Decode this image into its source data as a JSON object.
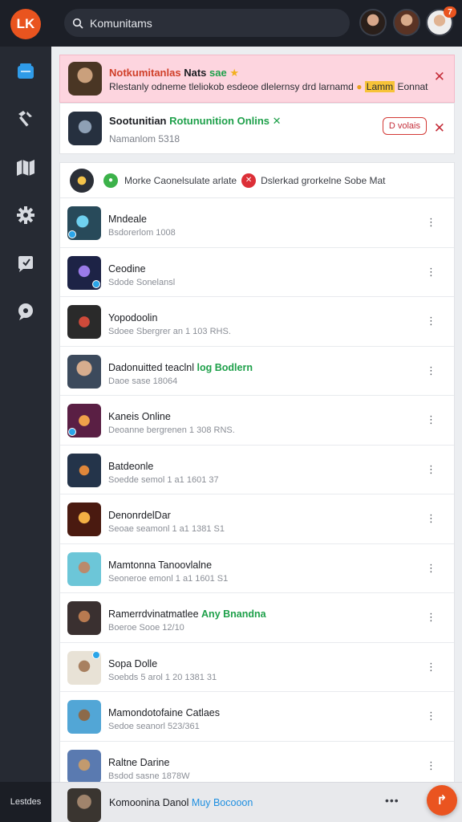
{
  "colors": {
    "accent": "#e9541f",
    "topbar": "#1c1f27",
    "sidebar": "#262a33",
    "notif_bg": "#fdd5df",
    "green": "#1ea04a",
    "blue": "#1f8fe0"
  },
  "app": {
    "logo_text": "LK"
  },
  "search": {
    "value": "Komunitams",
    "icon": "search-icon"
  },
  "header": {
    "notification_count": "7"
  },
  "sidebar": {
    "items": [
      {
        "icon": "library-icon",
        "active": true
      },
      {
        "icon": "tools-icon"
      },
      {
        "icon": "map-icon"
      },
      {
        "icon": "gear-icon"
      },
      {
        "icon": "clock-icon"
      },
      {
        "icon": "chat-icon"
      }
    ],
    "footer_label": "Lestdes"
  },
  "notifications": [
    {
      "title": "Notkumitanlas",
      "title_suffix": "Nats",
      "title_tag": "sae",
      "subtitle": "Rlestanly odneme tleliokob esdeoe dlelernsy drd larnamd",
      "subtitle_tag": "Lamm",
      "subtitle_suffix": "Eonnat",
      "close": "✕"
    },
    {
      "title": "Sootunitian",
      "title_highlight": "Rotununition Onlins",
      "subtitle": "Namanlom 5318",
      "action_label": "D volais",
      "close": "✕"
    }
  ],
  "list": {
    "header": {
      "text_a": "Morke Caonelsulate arlate",
      "text_b": "Dslerkad grorkelne Sobe Mat"
    },
    "rows": [
      {
        "title": "Mndeale",
        "title_extra": "",
        "subtitle": "Bsdorerlom 1008"
      },
      {
        "title": "Ceodine",
        "title_extra": "",
        "subtitle": "Sdode Sonelansl"
      },
      {
        "title": "Yopodoolin",
        "title_extra": "",
        "subtitle": "Sdoee Sbergrer an 1 103 RHS."
      },
      {
        "title": "Dadonuitted teaclnl",
        "title_extra": "log Bodlern",
        "subtitle": "Daoe sase 18064"
      },
      {
        "title": "Kaneis Online",
        "title_extra": "",
        "subtitle": "Deoanne bergrenen 1 308 RNS."
      },
      {
        "title": "Batdeonle",
        "title_extra": "",
        "subtitle": "Soedde semol 1 a1 1601 37"
      },
      {
        "title": "DenonrdelDar",
        "title_extra": "",
        "subtitle": "Seoae seamonl 1 a1 1381 S1"
      },
      {
        "title": "Mamtonna Tanoovlalne",
        "title_extra": "",
        "subtitle": "Seoneroe emonl 1 a1 1601 S1"
      },
      {
        "title": "Ramerrdvinatmatlee",
        "title_extra": "Any Bnandna",
        "subtitle": "Boeroe Sooe 12/10"
      },
      {
        "title": "Sopa Dolle",
        "title_extra": "",
        "subtitle": "Soebds 5 arol 1 20 1381 31"
      },
      {
        "title": "Mamondotofaine Catlaes",
        "title_extra": "",
        "subtitle": "Sedoe seanorl 523/361"
      },
      {
        "title": "Raltne Darine",
        "title_extra": "",
        "subtitle": "Bsdod sasne 1878W"
      }
    ],
    "row_menu": "⋮"
  },
  "bottom_bar": {
    "title": "Komoonina Danol",
    "title_extra": "Muy Bocooon",
    "more": "•••"
  },
  "fab": {
    "icon": "share-icon",
    "label": "↱"
  }
}
